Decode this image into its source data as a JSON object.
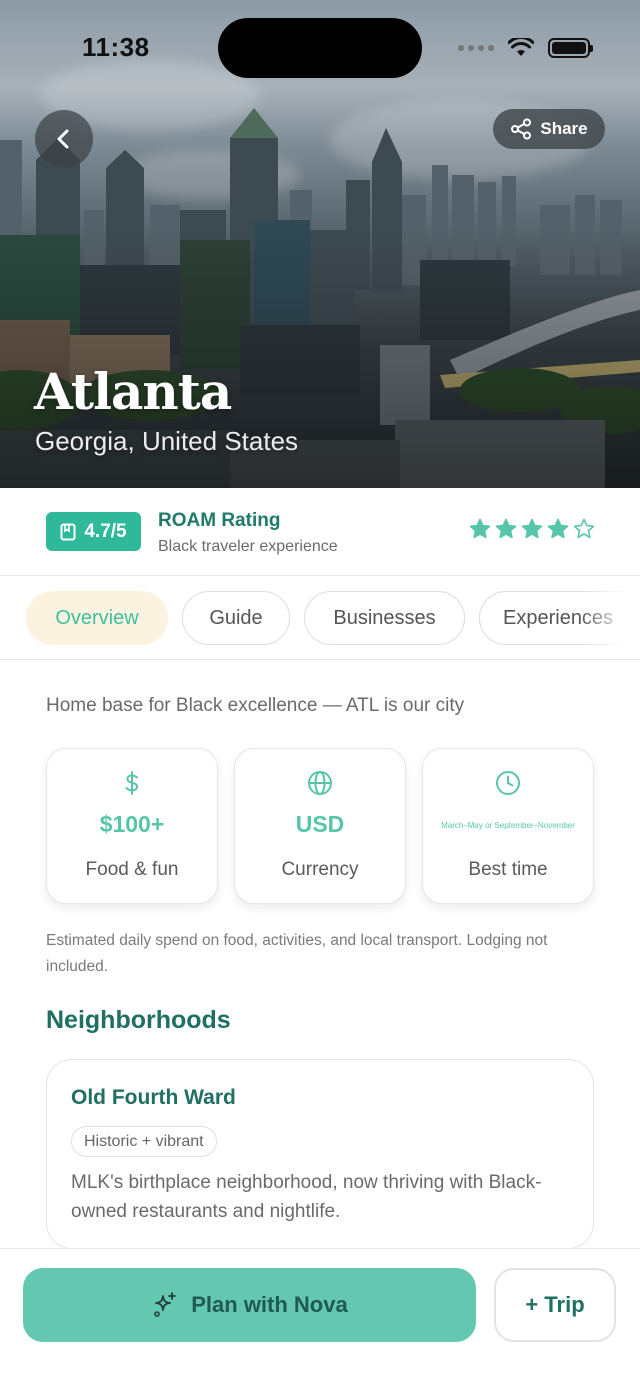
{
  "status_bar": {
    "time": "11:38"
  },
  "hero": {
    "share_label": "Share",
    "city": "Atlanta",
    "region": "Georgia, United States"
  },
  "rating": {
    "score": "4.7/5",
    "title": "ROAM Rating",
    "subtitle": "Black traveler experience",
    "stars_filled": 4,
    "stars_total": 5,
    "star_color": "#57c5aa"
  },
  "tabs": [
    {
      "label": "Overview",
      "active": true
    },
    {
      "label": "Guide",
      "active": false
    },
    {
      "label": "Businesses",
      "active": false
    },
    {
      "label": "Experiences",
      "active": false
    }
  ],
  "overview": {
    "tagline": "Home base for Black excellence — ATL is our city",
    "cards": [
      {
        "icon": "dollar-icon",
        "value": "$100+",
        "label": "Food & fun"
      },
      {
        "icon": "globe-icon",
        "value": "USD",
        "label": "Currency"
      },
      {
        "icon": "clock-icon",
        "value": "March–May or September–November",
        "label": "Best time"
      }
    ],
    "note": "Estimated daily spend on food, activities, and local transport. Lodging not included."
  },
  "neighborhoods": {
    "title": "Neighborhoods",
    "items": [
      {
        "name": "Old Fourth Ward",
        "tag": "Historic + vibrant",
        "description": "MLK's birthplace neighborhood, now thriving with Black-owned restaurants and nightlife."
      }
    ]
  },
  "actions": {
    "plan_label": "Plan with Nova",
    "trip_label": "+ Trip"
  },
  "colors": {
    "accent": "#57c5aa",
    "primary_button": "#64c8b0",
    "brand_dark": "#1f6f62",
    "badge": "#2fb89a"
  }
}
